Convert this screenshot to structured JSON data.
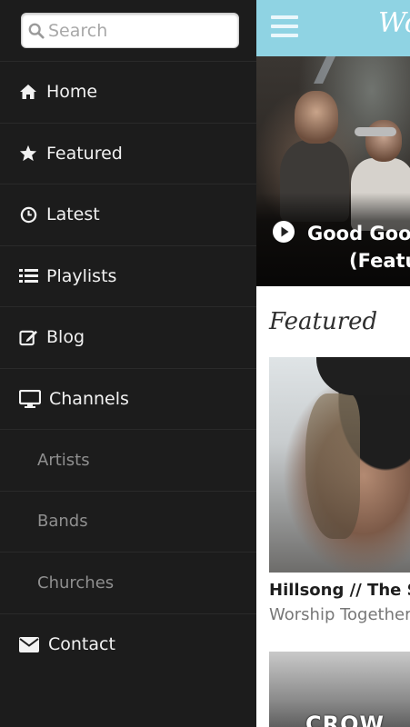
{
  "search": {
    "placeholder": "Search"
  },
  "menu": {
    "items": [
      {
        "label": "Home",
        "icon": "home-icon"
      },
      {
        "label": "Featured",
        "icon": "star-icon"
      },
      {
        "label": "Latest",
        "icon": "clock-icon"
      },
      {
        "label": "Playlists",
        "icon": "list-icon"
      },
      {
        "label": "Blog",
        "icon": "edit-icon"
      },
      {
        "label": "Channels",
        "icon": "monitor-icon"
      }
    ],
    "subitems": [
      {
        "label": "Artists"
      },
      {
        "label": "Bands"
      },
      {
        "label": "Churches"
      }
    ],
    "contact": {
      "label": "Contact",
      "icon": "envelope-icon"
    }
  },
  "header": {
    "brand": "Wo"
  },
  "hero": {
    "title_line1": "Good Good",
    "title_line2": "(Featu"
  },
  "featured": {
    "heading": "Featured",
    "card": {
      "title": "Hillsong // The St",
      "subtitle": "Worship Together"
    },
    "card2": {
      "image_text": "CROW"
    }
  },
  "colors": {
    "topbar": "#8fd3e3",
    "sidebar": "#1c1c1c",
    "divider": "#2a2a2a",
    "subitem_text": "#8f8f8f"
  }
}
